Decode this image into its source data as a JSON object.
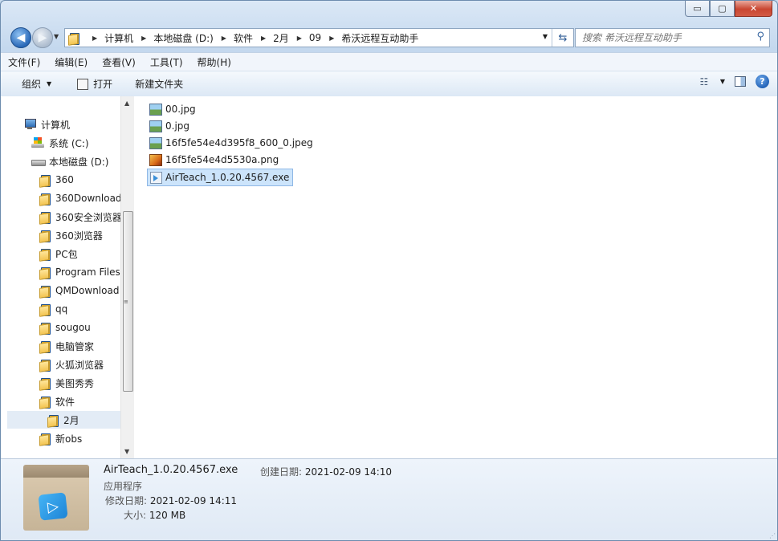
{
  "window": {
    "caption_buttons": {
      "minimize": "▭",
      "maximize": "▢",
      "close": "✕"
    }
  },
  "navigation": {
    "back_glyph": "◀",
    "forward_glyph": "▶",
    "breadcrumb": [
      "计算机",
      "本地磁盘 (D:)",
      "软件",
      "2月",
      "09",
      "希沃远程互动助手"
    ],
    "search_placeholder": "搜索 希沃远程互动助手"
  },
  "menubar": {
    "items": [
      "文件(F)",
      "编辑(E)",
      "查看(V)",
      "工具(T)",
      "帮助(H)"
    ]
  },
  "toolbar": {
    "organize": "组织",
    "open": "打开",
    "new_folder": "新建文件夹"
  },
  "nav_pane": {
    "computer": "计算机",
    "drive_c": "系统 (C:)",
    "drive_d": "本地磁盘 (D:)",
    "folders": [
      "360",
      "360Download",
      "360安全浏览器",
      "360浏览器",
      "PC包",
      "Program Files",
      "QMDownload",
      "qq",
      "sougou",
      "电脑管家",
      "火狐浏览器",
      "美图秀秀",
      "软件",
      "2月",
      "新obs"
    ],
    "selected": "2月"
  },
  "files": [
    {
      "name": "00.jpg",
      "type": "jpg"
    },
    {
      "name": "0.jpg",
      "type": "jpg"
    },
    {
      "name": "16f5fe54e4d395f8_600_0.jpeg",
      "type": "jpg"
    },
    {
      "name": "16f5fe54e4d5530a.png",
      "type": "png"
    },
    {
      "name": "AirTeach_1.0.20.4567.exe",
      "type": "exe",
      "selected": true
    }
  ],
  "details": {
    "name": "AirTeach_1.0.20.4567.exe",
    "type": "应用程序",
    "modified_label": "修改日期:",
    "modified_value": "2021-02-09 14:11",
    "size_label": "大小:",
    "size_value": "120 MB",
    "created_label": "创建日期:",
    "created_value": "2021-02-09 14:10"
  },
  "colors": {
    "accent": "#2a69b8",
    "selection": "#cce4fb"
  }
}
